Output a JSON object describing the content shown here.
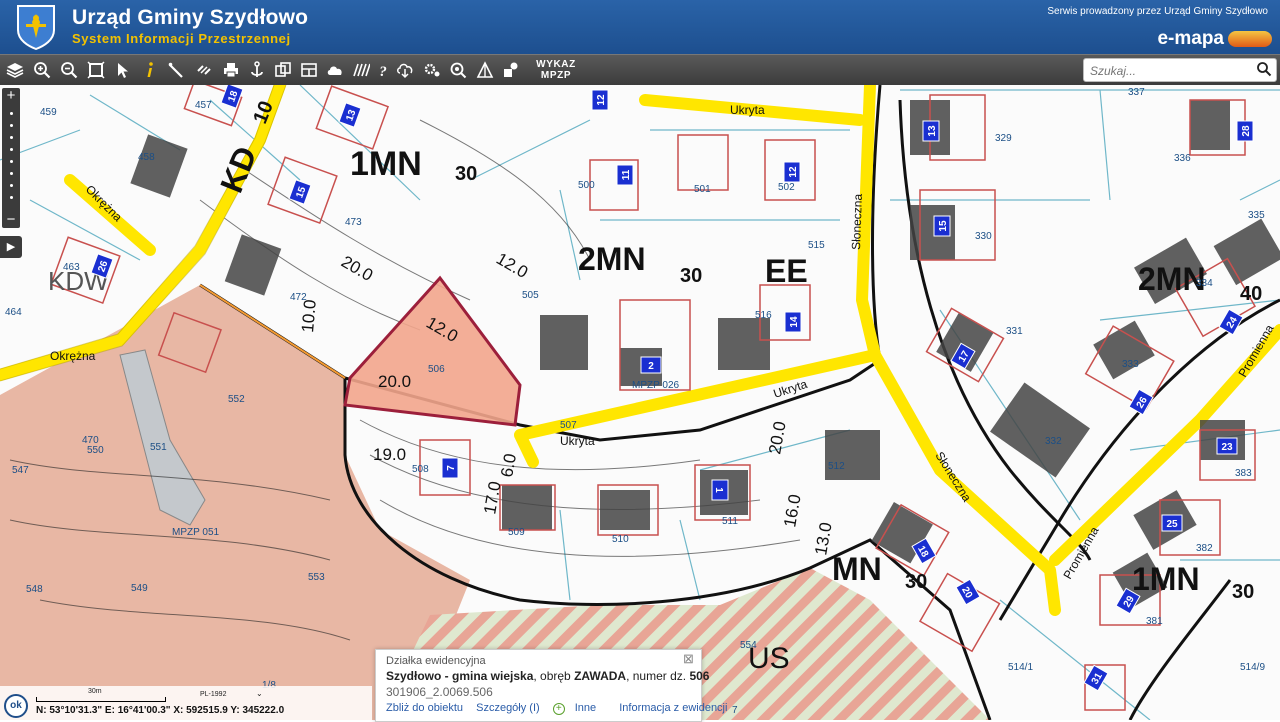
{
  "header": {
    "title": "Urząd Gminy Szydłowo",
    "subtitle": "System Informacji Przestrzennej",
    "service_text": "Serwis prowadzony przez Urząd Gminy Szydłowo",
    "brand": "e-mapa"
  },
  "toolbar": {
    "icons": [
      "layers-icon",
      "zoom-in-icon",
      "zoom-out-icon",
      "zoom-extent-icon",
      "select-pointer-icon",
      "info-icon",
      "measure-ruler-icon",
      "link-icon",
      "print-icon",
      "anchor-icon",
      "copy-icon",
      "layout-icon",
      "cloud-icon",
      "hatching-icon",
      "help-icon",
      "download-cloud-icon",
      "settings-icon",
      "search-zoom-icon",
      "measure-angle-icon",
      "shapes-icon"
    ],
    "wykaz_line1": "WYKAZ",
    "wykaz_line2": "MPZP"
  },
  "search": {
    "placeholder": "Szukaj..."
  },
  "map": {
    "zones": [
      "1MN",
      "2MN",
      "2MN",
      "1MN",
      "MN",
      "KD",
      "EE",
      "KDW",
      "US"
    ],
    "zone_numbers": [
      "30",
      "30",
      "40",
      "30",
      "30",
      "10"
    ],
    "street_names": [
      "Okrężna",
      "Okrężna",
      "Ukryta",
      "Ukryta",
      "Ukryta",
      "Słoneczna",
      "Słoneczna",
      "Promienna",
      "Promienna"
    ],
    "parcel_numbers": [
      "459",
      "457",
      "458",
      "463",
      "464",
      "473",
      "472",
      "505",
      "500",
      "501",
      "502",
      "515",
      "516",
      "506",
      "507",
      "508",
      "509",
      "510",
      "511",
      "512",
      "513",
      "337",
      "336",
      "329",
      "330",
      "331",
      "332",
      "333",
      "334",
      "335",
      "381",
      "382",
      "383",
      "514/1",
      "514/9",
      "547",
      "548",
      "549",
      "550",
      "551",
      "552",
      "553",
      "554",
      "470",
      "1/8",
      "7"
    ],
    "building_numbers": [
      "18",
      "12",
      "11",
      "12",
      "15",
      "13",
      "17",
      "26",
      "28",
      "2",
      "14",
      "1",
      "7",
      "24",
      "26",
      "23",
      "25",
      "29",
      "31",
      "20",
      "16",
      "18",
      "13",
      "15"
    ],
    "measurements": [
      "20.0",
      "12.0",
      "12.0",
      "20.0",
      "19.0",
      "10.0",
      "16.0",
      "13.0",
      "20.0",
      "6.0",
      "17.0"
    ],
    "plan_labels": [
      "MPZP 026",
      "MPZP 051"
    ],
    "highlighted_parcel": "506",
    "highlight_color": "#f2a58c",
    "highlight_border": "#9c1f3b",
    "road_color": "#ffe600",
    "residential_color": "#e8b7a4",
    "us_hatch_color": "#e79a8c"
  },
  "popup": {
    "title": "Działka ewidencyjna",
    "parcel_location": "Szydłowo - gmina wiejska",
    "obreb_label": ", obręb ",
    "obreb_value": "ZAWADA",
    "number_label": ", numer dz.",
    "number_value": "506",
    "parcel_id": "301906_2.0069.506",
    "links": {
      "zoom": "Zbliż do obiektu",
      "details": "Szczegóły (I)",
      "other": "Inne",
      "registry": "Informacja z ewidencji"
    }
  },
  "status": {
    "scale_label": "30m",
    "projection": "PL-1992",
    "coords": "N: 53°10'31.3\" E: 16°41'00.3\"  X: 592515.9  Y: 345222.0",
    "ok_label": "ok"
  }
}
